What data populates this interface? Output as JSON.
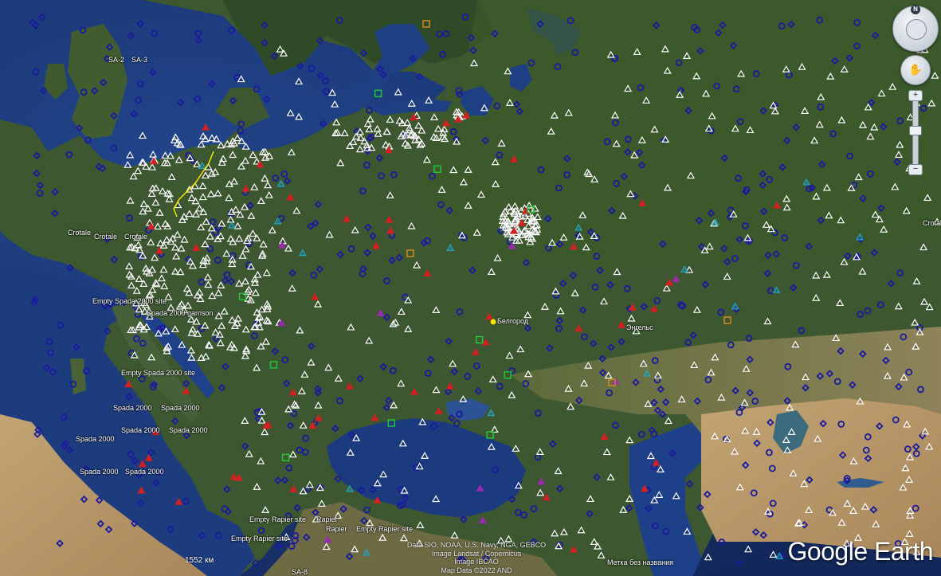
{
  "app": {
    "logo": "Google Earth"
  },
  "attribution": [
    "Data SIO, NOAA, U.S. Navy, NGA, GEBCO",
    "Image Landsat / Copernicus",
    "Image IBCAO",
    "Map Data ©2022 AND"
  ],
  "scale": "1552 км",
  "controls": {
    "compass_letter": "N",
    "zoom_in": "+",
    "zoom_out": "−"
  },
  "colors": {
    "ocean": "#1c3b7a",
    "deep_ocean": "#152d63",
    "land_green": "#3f5a2e",
    "land_dark": "#2e4424",
    "steppe": "#6c6a45",
    "desert": "#b59a6a",
    "marker_blue": "#1a1a9e",
    "marker_white": "#ffffff",
    "marker_red": "#d42020",
    "marker_cyan": "#23a6c4",
    "marker_green": "#22c43a",
    "marker_purple": "#9a2ab0",
    "marker_yellow": "#f2e600"
  },
  "place_labels": [
    {
      "id": "sa2",
      "text": "SA-2"
    },
    {
      "id": "sa3",
      "text": "SA-3"
    },
    {
      "id": "crotale1",
      "text": "Crotale"
    },
    {
      "id": "crotale2",
      "text": "Crotale"
    },
    {
      "id": "crotale3",
      "text": "Crotale"
    },
    {
      "id": "empty_spada1",
      "text": "Empty Spada 2000 site"
    },
    {
      "id": "spada_garrison",
      "text": "Spada 2000 garrison"
    },
    {
      "id": "empty_spada2",
      "text": "Empty Spada 2000 site"
    },
    {
      "id": "spada1",
      "text": "Spada 2000"
    },
    {
      "id": "spada2",
      "text": "Spada 2000"
    },
    {
      "id": "spada3",
      "text": "Spada 2000"
    },
    {
      "id": "spada4",
      "text": "Spada 2000"
    },
    {
      "id": "spada5",
      "text": "Spada 2000"
    },
    {
      "id": "spada6",
      "text": "Spada 2000"
    },
    {
      "id": "spada7",
      "text": "Spada 2000"
    },
    {
      "id": "empty_rapier1",
      "text": "Empty Rapier site"
    },
    {
      "id": "rapier1",
      "text": "Rapier"
    },
    {
      "id": "rapier2",
      "text": "Rapier"
    },
    {
      "id": "empty_rapier2",
      "text": "Empty Rapier site"
    },
    {
      "id": "empty_rapier3",
      "text": "Empty Rapier site"
    },
    {
      "id": "sa8",
      "text": "SA-8"
    },
    {
      "id": "belgorod",
      "text": "Белгород"
    },
    {
      "id": "engels",
      "text": "Энгельс"
    },
    {
      "id": "untitled",
      "text": "Метка без названия"
    },
    {
      "id": "crotale_e",
      "text": "Crotale"
    }
  ]
}
